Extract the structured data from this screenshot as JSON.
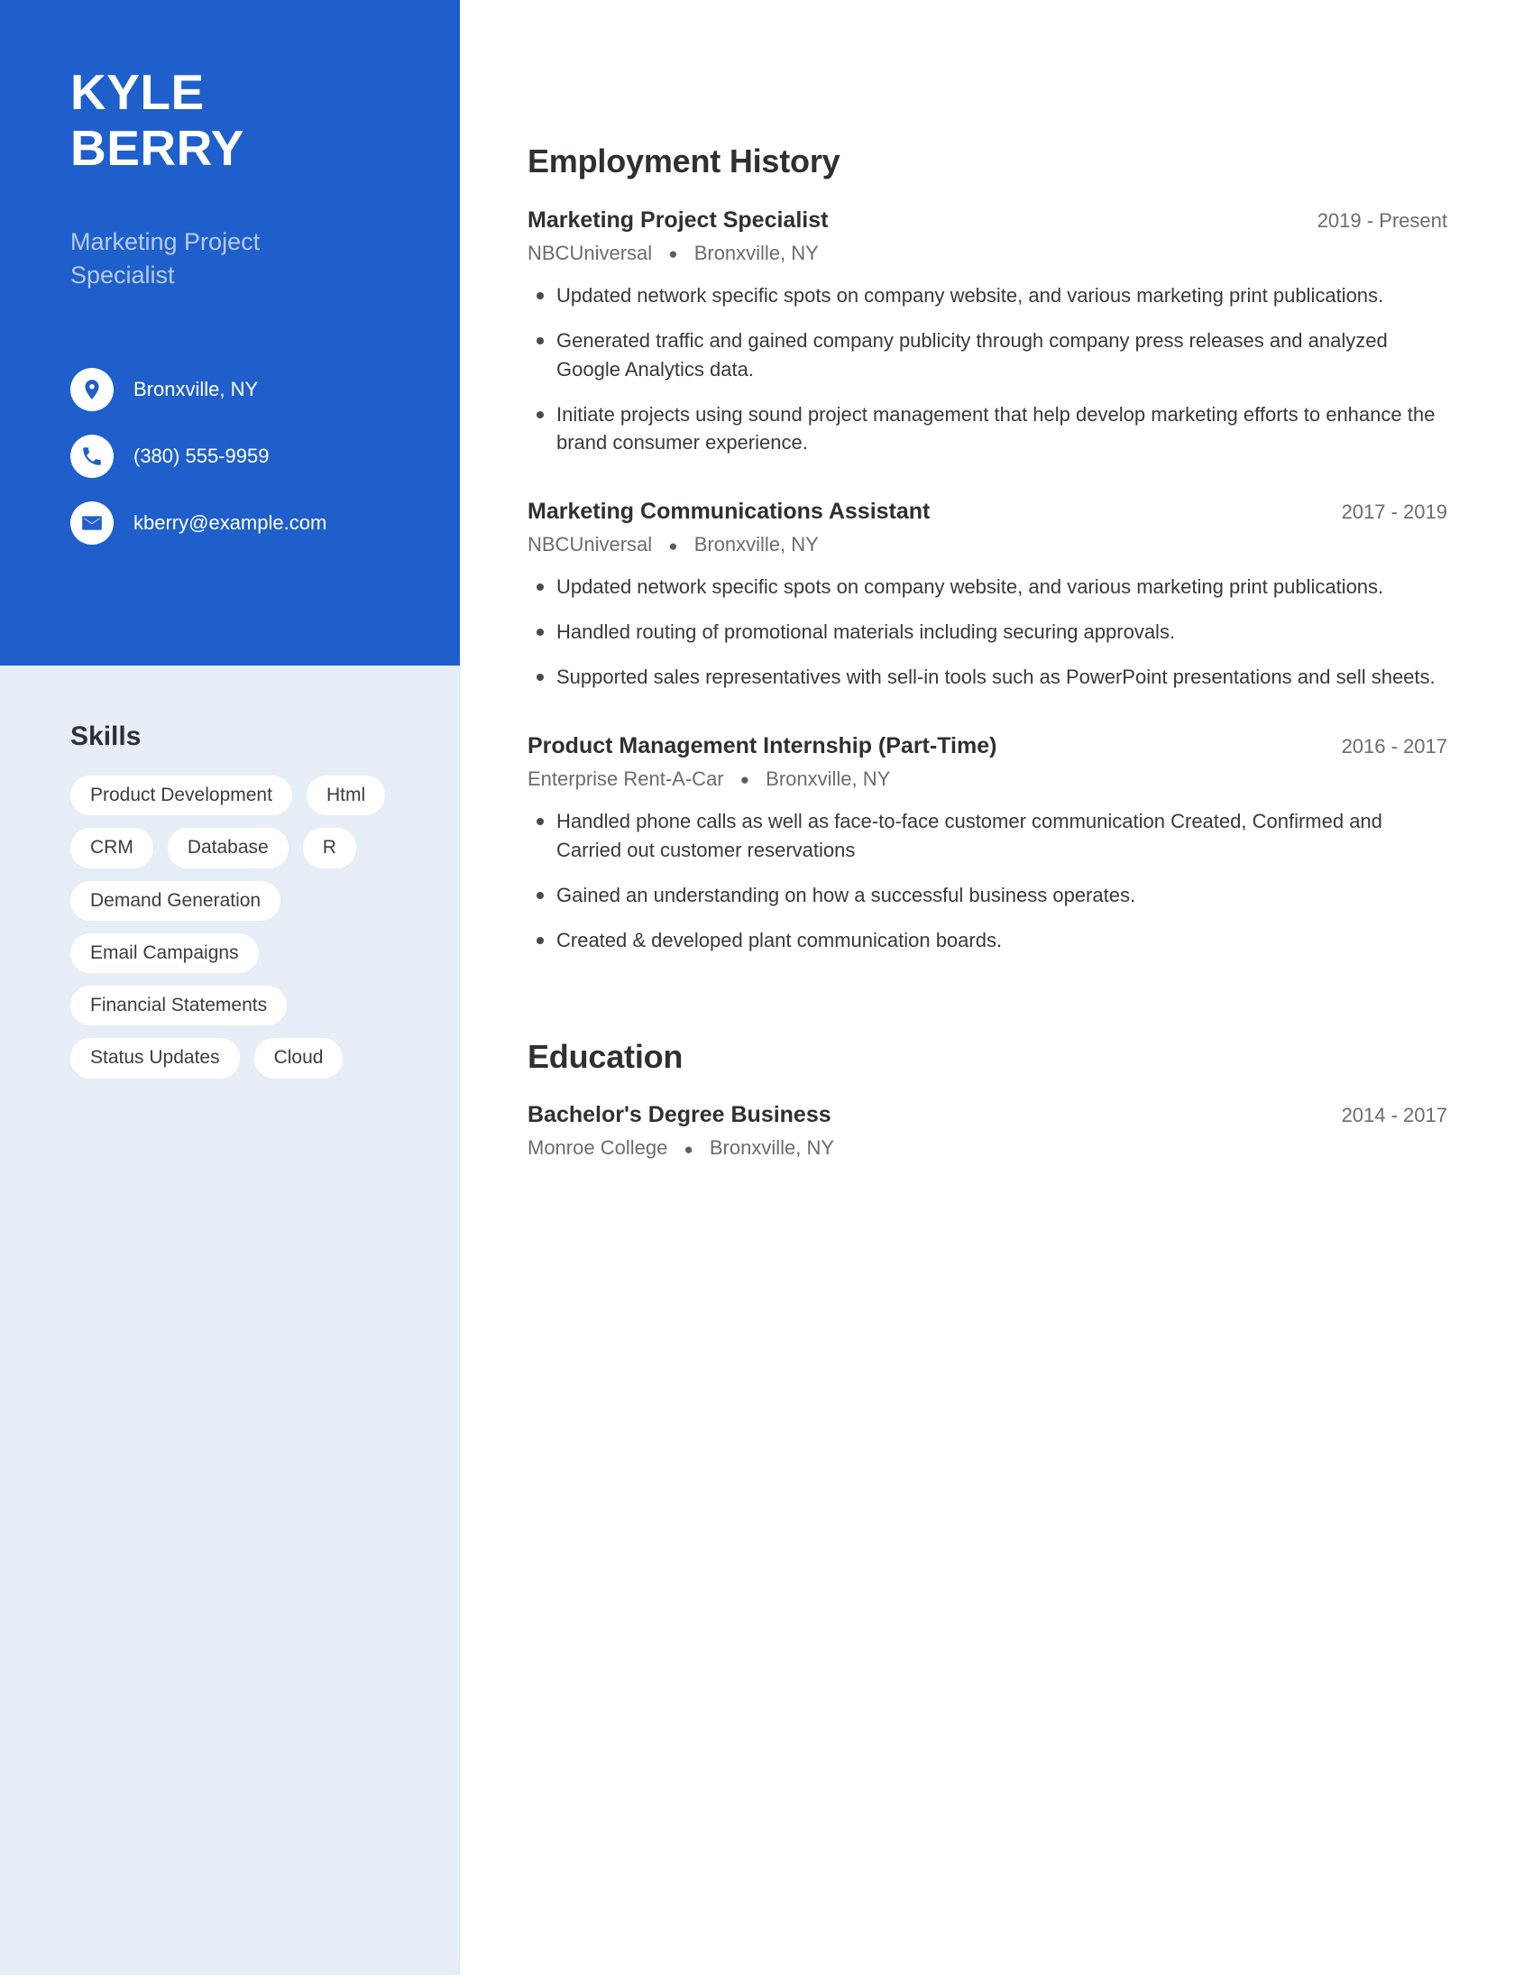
{
  "profile": {
    "first_name": "KYLE",
    "last_name": "BERRY",
    "job_title": "Marketing Project Specialist",
    "contacts": [
      {
        "icon": "location-pin-icon",
        "text": "Bronxville, NY"
      },
      {
        "icon": "phone-icon",
        "text": "(380) 555-9959"
      },
      {
        "icon": "email-icon",
        "text": "kberry@example.com"
      }
    ]
  },
  "skills": {
    "title": "Skills",
    "items": [
      "Product Development",
      "Html",
      "CRM",
      "Database",
      "R",
      "Demand Generation",
      "Email Campaigns",
      "Financial Statements",
      "Status Updates",
      "Cloud"
    ]
  },
  "employment": {
    "title": "Employment History",
    "entries": [
      {
        "title": "Marketing Project Specialist",
        "dates": "2019 - Present",
        "company": "NBCUniversal",
        "location": "Bronxville, NY",
        "bullets": [
          "Updated network specific spots on company website, and various marketing print publications.",
          "Generated traffic and gained company publicity through company press releases and analyzed Google Analytics data.",
          "Initiate projects using sound project management that help develop marketing efforts to enhance the brand consumer experience."
        ]
      },
      {
        "title": "Marketing Communications Assistant",
        "dates": "2017 - 2019",
        "company": "NBCUniversal",
        "location": "Bronxville, NY",
        "bullets": [
          "Updated network specific spots on company website, and various marketing print publications.",
          "Handled routing of promotional materials including securing approvals.",
          "Supported sales representatives with sell-in tools such as PowerPoint presentations and sell sheets."
        ]
      },
      {
        "title": "Product Management Internship (Part-Time)",
        "dates": "2016 - 2017",
        "company": "Enterprise Rent-A-Car",
        "location": "Bronxville, NY",
        "bullets": [
          "Handled phone calls as well as face-to-face customer communication Created, Confirmed and Carried out customer reservations",
          "Gained an understanding on how a successful business operates.",
          "Created & developed plant communication boards."
        ]
      }
    ]
  },
  "education": {
    "title": "Education",
    "entries": [
      {
        "title": "Bachelor's Degree Business",
        "dates": "2014 - 2017",
        "school": "Monroe College",
        "location": "Bronxville, NY"
      }
    ]
  },
  "theme": {
    "accent": "#1f5fcc",
    "sidebar_bg": "#e8eef8",
    "subtitle_color": "#b6cbee",
    "heading_color": "#2f3033",
    "muted_text": "#6b6c6f"
  }
}
